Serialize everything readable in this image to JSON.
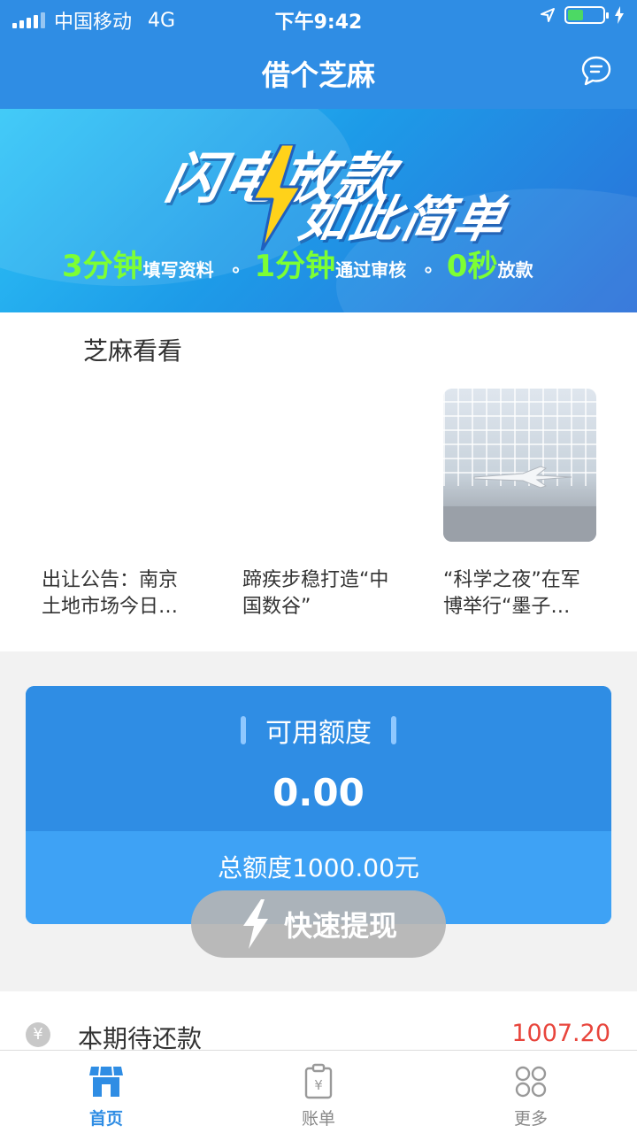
{
  "status_bar": {
    "carrier": "中国移动",
    "network": "4G",
    "time": "下午9:42",
    "battery_level": 0.45
  },
  "nav": {
    "title": "借个芝麻",
    "right_icon": "chat-bubble-icon"
  },
  "banner": {
    "headline_1": "闪电放款",
    "headline_2": "如此简单",
    "steps": [
      {
        "num": "3分钟",
        "text": "填写资料"
      },
      {
        "num": "1分钟",
        "text": "通过审核"
      },
      {
        "num": "0秒",
        "text": "放款"
      }
    ],
    "dot": "∘"
  },
  "articles": {
    "section_title": "芝麻看看",
    "items": [
      {
        "title": "出让公告：南京土地市场今日…"
      },
      {
        "title": "蹄疾步稳打造“中国数谷”"
      },
      {
        "title": "“科学之夜”在军博举行“墨子…"
      }
    ]
  },
  "credit": {
    "available_label": "可用额度",
    "available_amount": "0.00",
    "total_label": "总额度1000.00元",
    "withdraw_label": "快速提现"
  },
  "repay": {
    "label": "本期待还款",
    "amount": "1007.20",
    "icon_char": "¥"
  },
  "tabs": [
    {
      "label": "首页",
      "icon": "store-icon",
      "active": true
    },
    {
      "label": "账单",
      "icon": "bill-icon",
      "active": false
    },
    {
      "label": "更多",
      "icon": "more-icon",
      "active": false
    }
  ],
  "colors": {
    "primary": "#2f8de4",
    "accent_green": "#7dff33",
    "amount_red": "#e8453c"
  }
}
